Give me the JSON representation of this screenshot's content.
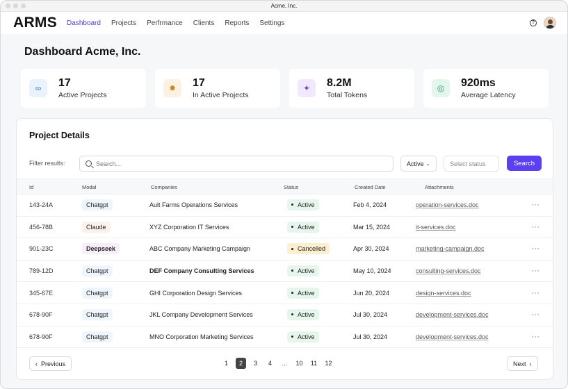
{
  "window": {
    "title": "Acme, Inc."
  },
  "nav": {
    "logo": "ARMS",
    "links": [
      "Dashboard",
      "Projects",
      "Perfrmance",
      "Clients",
      "Reports",
      "Settings"
    ],
    "active": "Dashboard",
    "help_icon": "help-circle-icon",
    "avatar_icon": "user-avatar"
  },
  "page": {
    "title": "Dashboard Acme, Inc."
  },
  "stats": [
    {
      "value": "17",
      "label": "Active Projects",
      "icon": "link-icon",
      "icon_bg": "#eaf2fc",
      "icon_color": "#3a7fd0"
    },
    {
      "value": "17",
      "label": "In Active Projects",
      "icon": "spinner-icon",
      "icon_bg": "#fdf1e2",
      "icon_color": "#c9882d"
    },
    {
      "value": "8.2M",
      "label": "Total Tokens",
      "icon": "sparkle-icon",
      "icon_bg": "#f1e9fb",
      "icon_color": "#7a45c8"
    },
    {
      "value": "920ms",
      "label": "Average Latency",
      "icon": "gauge-icon",
      "icon_bg": "#e3f6ee",
      "icon_color": "#2f9466"
    }
  ],
  "details": {
    "title": "Project Details",
    "filter_label": "Filter results:",
    "search_placeholder": "Search...",
    "status_value": "Active",
    "status_placeholder": "Select status",
    "search_button": "Search",
    "columns": [
      "Id",
      "Modal",
      "Companies",
      "Status",
      "Created Date",
      "Attachments"
    ],
    "rows": [
      {
        "id": "143-24A",
        "model": "Chatgpt",
        "company": "Ault Farms Operations Services",
        "status": "Active",
        "date": "Feb 4, 2024",
        "attachment": "operation-services.doc"
      },
      {
        "id": "456-78B",
        "model": "Claude",
        "company": "XYZ Corporation IT Services",
        "status": "Active",
        "date": "Mar 15, 2024",
        "attachment": "it-services.doc"
      },
      {
        "id": "901-23C",
        "model": "Deepseek",
        "company": "ABC Company Marketing Campaign",
        "status": "Cancelled",
        "date": "Apr 30, 2024",
        "attachment": "marketing-campaign.doc"
      },
      {
        "id": "789-12D",
        "model": "Chatgpt",
        "company": "DEF Company Consulting Services",
        "status": "Active",
        "date": "May 10, 2024",
        "attachment": "consulting-services.doc"
      },
      {
        "id": "345-67E",
        "model": "Chatgpt",
        "company": "GHI Corporation Design Services",
        "status": "Active",
        "date": "Jun 20, 2024",
        "attachment": "design-services.doc"
      },
      {
        "id": "678-90F",
        "model": "Chatgpt",
        "company": "JKL Company Development Services",
        "status": "Active",
        "date": "Jul 30, 2024",
        "attachment": "development-services.doc"
      },
      {
        "id": "678-90F",
        "model": "Chatgpt",
        "company": "MNO Corporation Marketing Services",
        "status": "Active",
        "date": "Jul 30, 2024",
        "attachment": "development-services.doc"
      }
    ],
    "more_label": "···"
  },
  "pagination": {
    "prev": "Previous",
    "next": "Next",
    "pages": [
      "1",
      "2",
      "3",
      "4",
      "...",
      "10",
      "11",
      "12"
    ],
    "current": "2"
  }
}
